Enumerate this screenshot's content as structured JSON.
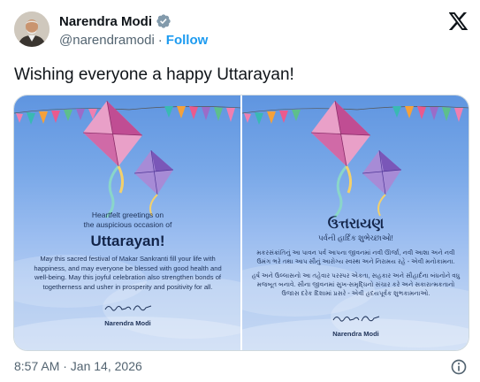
{
  "author": {
    "name": "Narendra Modi",
    "handle": "@narendramodi",
    "separator": "·",
    "follow_label": "Follow"
  },
  "tweet": {
    "text": "Wishing everyone a happy Uttarayan!",
    "timestamp": "8:57 AM · Jan 14, 2026"
  },
  "media": {
    "english": {
      "greeting_line1": "Heartfelt greetings on",
      "greeting_line2": "the auspicious occasion of",
      "title": "Uttarayan!",
      "body": "May this sacred festival of Makar Sankranti fill your life with happiness, and may everyone be blessed with good health and well-being. May this joyful celebration also strengthen bonds of togetherness and usher in prosperity and positivity for all.",
      "signature_name": "Narendra Modi"
    },
    "gujarati": {
      "title": "ઉત્તરાયણ",
      "subtitle": "પર્વની હાર્દિક શુભેચ્છાઓ!",
      "para1": "મકરસંક્રાંતિનું આ પાવન પર્વ આપના જીવનમાં નવી ઊર્જા, નવી આશા અને નવી ઉમંગ ભરે તથા આપ સૌનું આરોગ્ય સ્વસ્થ અને નિરામય રહે - એવી મનોકામના.",
      "para2": "હર્ષ અને ઉલ્લાસનો આ તહેવાર પરસ્પર એકતા, સહકાર અને સૌહાર્દના બંધનોને વધુ મજબૂત બનાવે. સૌના જીવનમાં સુખ-સમૃદ્ધિનો સંચાર કરે અને સકારાત્મકતાનો ઉજાસ દરેક દિશામાં પ્રસરે - એવી હૃદયપૂર્વક શુભકામનાઓ.",
      "signature_name": "Narendra Modi"
    }
  },
  "icons": {
    "verified": "verified-badge-icon",
    "x_logo": "x-logo-icon",
    "info": "info-icon"
  },
  "colors": {
    "accent": "#1d9bf0",
    "secondary_text": "#536471",
    "verified_badge": "#829aab"
  }
}
